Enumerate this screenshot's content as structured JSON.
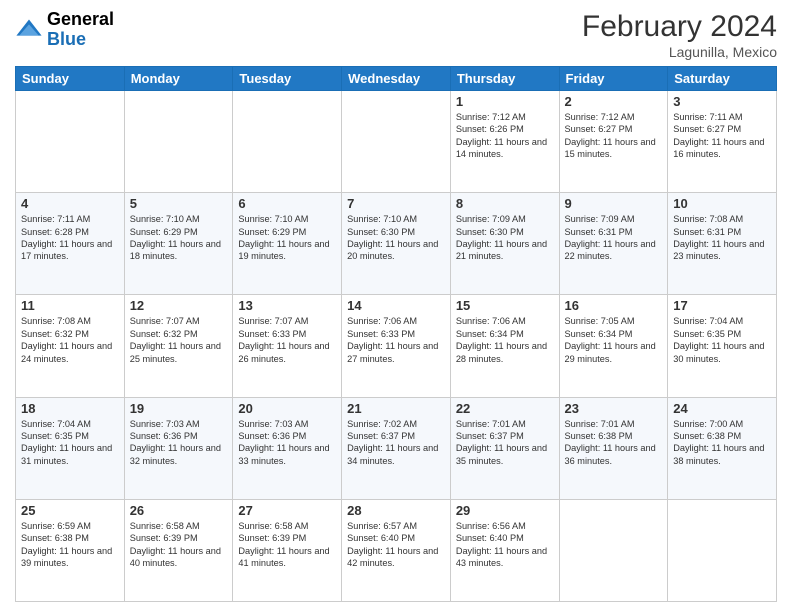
{
  "header": {
    "logo": {
      "line1": "General",
      "line2": "Blue"
    },
    "title": "February 2024",
    "location": "Lagunilla, Mexico"
  },
  "days_of_week": [
    "Sunday",
    "Monday",
    "Tuesday",
    "Wednesday",
    "Thursday",
    "Friday",
    "Saturday"
  ],
  "weeks": [
    [
      {
        "day": "",
        "info": ""
      },
      {
        "day": "",
        "info": ""
      },
      {
        "day": "",
        "info": ""
      },
      {
        "day": "",
        "info": ""
      },
      {
        "day": "1",
        "info": "Sunrise: 7:12 AM\nSunset: 6:26 PM\nDaylight: 11 hours and 14 minutes."
      },
      {
        "day": "2",
        "info": "Sunrise: 7:12 AM\nSunset: 6:27 PM\nDaylight: 11 hours and 15 minutes."
      },
      {
        "day": "3",
        "info": "Sunrise: 7:11 AM\nSunset: 6:27 PM\nDaylight: 11 hours and 16 minutes."
      }
    ],
    [
      {
        "day": "4",
        "info": "Sunrise: 7:11 AM\nSunset: 6:28 PM\nDaylight: 11 hours and 17 minutes."
      },
      {
        "day": "5",
        "info": "Sunrise: 7:10 AM\nSunset: 6:29 PM\nDaylight: 11 hours and 18 minutes."
      },
      {
        "day": "6",
        "info": "Sunrise: 7:10 AM\nSunset: 6:29 PM\nDaylight: 11 hours and 19 minutes."
      },
      {
        "day": "7",
        "info": "Sunrise: 7:10 AM\nSunset: 6:30 PM\nDaylight: 11 hours and 20 minutes."
      },
      {
        "day": "8",
        "info": "Sunrise: 7:09 AM\nSunset: 6:30 PM\nDaylight: 11 hours and 21 minutes."
      },
      {
        "day": "9",
        "info": "Sunrise: 7:09 AM\nSunset: 6:31 PM\nDaylight: 11 hours and 22 minutes."
      },
      {
        "day": "10",
        "info": "Sunrise: 7:08 AM\nSunset: 6:31 PM\nDaylight: 11 hours and 23 minutes."
      }
    ],
    [
      {
        "day": "11",
        "info": "Sunrise: 7:08 AM\nSunset: 6:32 PM\nDaylight: 11 hours and 24 minutes."
      },
      {
        "day": "12",
        "info": "Sunrise: 7:07 AM\nSunset: 6:32 PM\nDaylight: 11 hours and 25 minutes."
      },
      {
        "day": "13",
        "info": "Sunrise: 7:07 AM\nSunset: 6:33 PM\nDaylight: 11 hours and 26 minutes."
      },
      {
        "day": "14",
        "info": "Sunrise: 7:06 AM\nSunset: 6:33 PM\nDaylight: 11 hours and 27 minutes."
      },
      {
        "day": "15",
        "info": "Sunrise: 7:06 AM\nSunset: 6:34 PM\nDaylight: 11 hours and 28 minutes."
      },
      {
        "day": "16",
        "info": "Sunrise: 7:05 AM\nSunset: 6:34 PM\nDaylight: 11 hours and 29 minutes."
      },
      {
        "day": "17",
        "info": "Sunrise: 7:04 AM\nSunset: 6:35 PM\nDaylight: 11 hours and 30 minutes."
      }
    ],
    [
      {
        "day": "18",
        "info": "Sunrise: 7:04 AM\nSunset: 6:35 PM\nDaylight: 11 hours and 31 minutes."
      },
      {
        "day": "19",
        "info": "Sunrise: 7:03 AM\nSunset: 6:36 PM\nDaylight: 11 hours and 32 minutes."
      },
      {
        "day": "20",
        "info": "Sunrise: 7:03 AM\nSunset: 6:36 PM\nDaylight: 11 hours and 33 minutes."
      },
      {
        "day": "21",
        "info": "Sunrise: 7:02 AM\nSunset: 6:37 PM\nDaylight: 11 hours and 34 minutes."
      },
      {
        "day": "22",
        "info": "Sunrise: 7:01 AM\nSunset: 6:37 PM\nDaylight: 11 hours and 35 minutes."
      },
      {
        "day": "23",
        "info": "Sunrise: 7:01 AM\nSunset: 6:38 PM\nDaylight: 11 hours and 36 minutes."
      },
      {
        "day": "24",
        "info": "Sunrise: 7:00 AM\nSunset: 6:38 PM\nDaylight: 11 hours and 38 minutes."
      }
    ],
    [
      {
        "day": "25",
        "info": "Sunrise: 6:59 AM\nSunset: 6:38 PM\nDaylight: 11 hours and 39 minutes."
      },
      {
        "day": "26",
        "info": "Sunrise: 6:58 AM\nSunset: 6:39 PM\nDaylight: 11 hours and 40 minutes."
      },
      {
        "day": "27",
        "info": "Sunrise: 6:58 AM\nSunset: 6:39 PM\nDaylight: 11 hours and 41 minutes."
      },
      {
        "day": "28",
        "info": "Sunrise: 6:57 AM\nSunset: 6:40 PM\nDaylight: 11 hours and 42 minutes."
      },
      {
        "day": "29",
        "info": "Sunrise: 6:56 AM\nSunset: 6:40 PM\nDaylight: 11 hours and 43 minutes."
      },
      {
        "day": "",
        "info": ""
      },
      {
        "day": "",
        "info": ""
      }
    ]
  ]
}
